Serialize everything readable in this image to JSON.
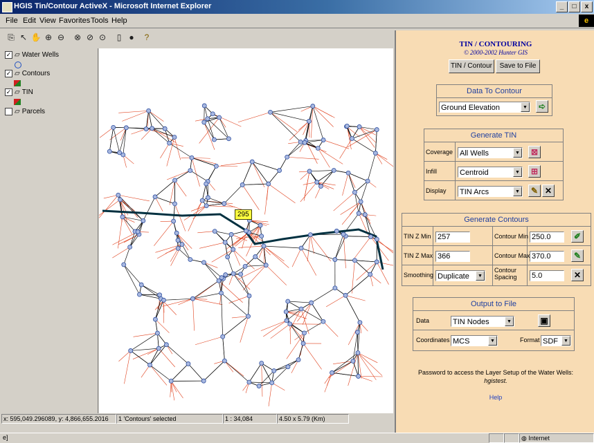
{
  "window": {
    "title": "HGIS Tin/Contour ActiveX - Microsoft Internet Explorer",
    "controls": [
      "_",
      "□",
      "x"
    ]
  },
  "menu": [
    "File",
    "Edit",
    "View",
    "Favorites",
    "Tools",
    "Help"
  ],
  "toolbar_icons": [
    "copy-icon",
    "arrow-pointer-icon",
    "pan-hand-icon",
    "zoom-in-icon",
    "zoom-out-icon",
    "zoom-extent-icon",
    "zoom-previous-icon",
    "zoom-layer-icon",
    "identify-icon",
    "record-icon",
    "help-icon"
  ],
  "layers": [
    {
      "name": "Water Wells",
      "checked": true,
      "symbol": "circle-symbol-icon"
    },
    {
      "name": "Contours",
      "checked": true,
      "symbol": "contour-symbol-icon"
    },
    {
      "name": "TIN",
      "checked": true,
      "symbol": "tin-symbol-icon"
    },
    {
      "name": "Parcels",
      "checked": false,
      "symbol": ""
    }
  ],
  "map": {
    "label": "295"
  },
  "status": {
    "coords": "x: 595,049.296089, y: 4,866,655.2016",
    "selection": "1 'Contours' selected",
    "scale": "1 : 34,084",
    "extent": "4.50 x 5.79 (Km)"
  },
  "ie_status": {
    "icon_text": "e]",
    "zone": "Internet"
  },
  "panel": {
    "title": "TIN / CONTOURING",
    "copyright": "© 2000-2002 Hunter GIS",
    "buttons": {
      "tin_contour": "TIN / Contour",
      "save_to_file": "Save to File"
    },
    "data_to_contour": {
      "title": "Data To Contour",
      "value": "Ground Elevation"
    },
    "generate_tin": {
      "title": "Generate TIN",
      "coverage_label": "Coverage",
      "coverage_value": "All Wells",
      "infill_label": "Infill",
      "infill_value": "Centroid",
      "display_label": "Display",
      "display_value": "TIN Arcs"
    },
    "generate_contours": {
      "title": "Generate Contours",
      "tin_z_min_label": "TIN Z Min",
      "tin_z_min": "257",
      "tin_z_max_label": "TIN Z Max",
      "tin_z_max": "366",
      "smoothing_label": "Smoothing",
      "smoothing_value": "Duplicate",
      "contour_min_label": "Contour Min",
      "contour_min": "250.0",
      "contour_max_label": "Contour Max",
      "contour_max": "370.0",
      "contour_spacing_label_1": "Contour",
      "contour_spacing_label_2": "Spacing",
      "contour_spacing": "5.0"
    },
    "output_to_file": {
      "title": "Output to File",
      "data_label": "Data",
      "data_value": "TIN Nodes",
      "coordinates_label": "Coordinates",
      "coordinates_value": "MCS",
      "format_label": "Format",
      "format_value": "SDF"
    },
    "password_line1": "Password to access the Layer Setup of the Water Wells:",
    "password_value": "hgistest.",
    "help_link": "Help"
  }
}
